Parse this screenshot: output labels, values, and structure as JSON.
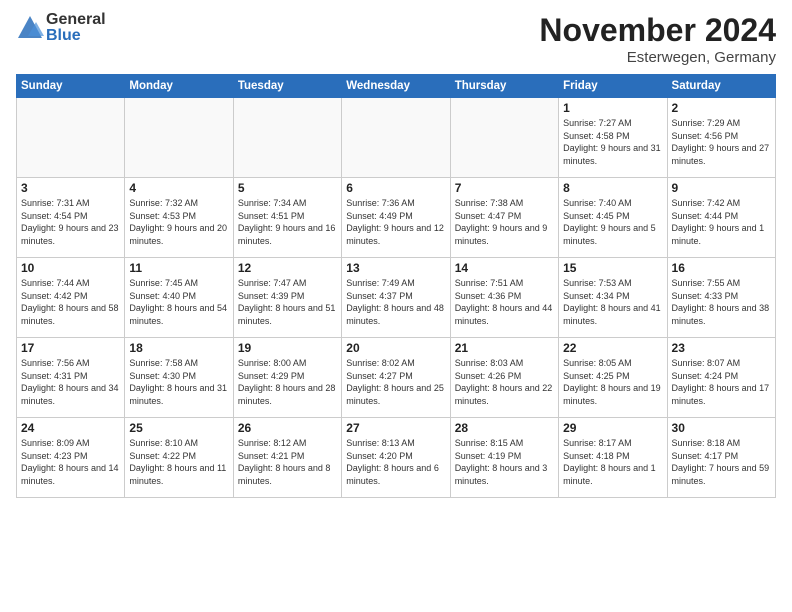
{
  "logo": {
    "general": "General",
    "blue": "Blue"
  },
  "header": {
    "month": "November 2024",
    "location": "Esterwegen, Germany"
  },
  "weekdays": [
    "Sunday",
    "Monday",
    "Tuesday",
    "Wednesday",
    "Thursday",
    "Friday",
    "Saturday"
  ],
  "weeks": [
    [
      {
        "day": "",
        "info": ""
      },
      {
        "day": "",
        "info": ""
      },
      {
        "day": "",
        "info": ""
      },
      {
        "day": "",
        "info": ""
      },
      {
        "day": "",
        "info": ""
      },
      {
        "day": "1",
        "info": "Sunrise: 7:27 AM\nSunset: 4:58 PM\nDaylight: 9 hours and 31 minutes."
      },
      {
        "day": "2",
        "info": "Sunrise: 7:29 AM\nSunset: 4:56 PM\nDaylight: 9 hours and 27 minutes."
      }
    ],
    [
      {
        "day": "3",
        "info": "Sunrise: 7:31 AM\nSunset: 4:54 PM\nDaylight: 9 hours and 23 minutes."
      },
      {
        "day": "4",
        "info": "Sunrise: 7:32 AM\nSunset: 4:53 PM\nDaylight: 9 hours and 20 minutes."
      },
      {
        "day": "5",
        "info": "Sunrise: 7:34 AM\nSunset: 4:51 PM\nDaylight: 9 hours and 16 minutes."
      },
      {
        "day": "6",
        "info": "Sunrise: 7:36 AM\nSunset: 4:49 PM\nDaylight: 9 hours and 12 minutes."
      },
      {
        "day": "7",
        "info": "Sunrise: 7:38 AM\nSunset: 4:47 PM\nDaylight: 9 hours and 9 minutes."
      },
      {
        "day": "8",
        "info": "Sunrise: 7:40 AM\nSunset: 4:45 PM\nDaylight: 9 hours and 5 minutes."
      },
      {
        "day": "9",
        "info": "Sunrise: 7:42 AM\nSunset: 4:44 PM\nDaylight: 9 hours and 1 minute."
      }
    ],
    [
      {
        "day": "10",
        "info": "Sunrise: 7:44 AM\nSunset: 4:42 PM\nDaylight: 8 hours and 58 minutes."
      },
      {
        "day": "11",
        "info": "Sunrise: 7:45 AM\nSunset: 4:40 PM\nDaylight: 8 hours and 54 minutes."
      },
      {
        "day": "12",
        "info": "Sunrise: 7:47 AM\nSunset: 4:39 PM\nDaylight: 8 hours and 51 minutes."
      },
      {
        "day": "13",
        "info": "Sunrise: 7:49 AM\nSunset: 4:37 PM\nDaylight: 8 hours and 48 minutes."
      },
      {
        "day": "14",
        "info": "Sunrise: 7:51 AM\nSunset: 4:36 PM\nDaylight: 8 hours and 44 minutes."
      },
      {
        "day": "15",
        "info": "Sunrise: 7:53 AM\nSunset: 4:34 PM\nDaylight: 8 hours and 41 minutes."
      },
      {
        "day": "16",
        "info": "Sunrise: 7:55 AM\nSunset: 4:33 PM\nDaylight: 8 hours and 38 minutes."
      }
    ],
    [
      {
        "day": "17",
        "info": "Sunrise: 7:56 AM\nSunset: 4:31 PM\nDaylight: 8 hours and 34 minutes."
      },
      {
        "day": "18",
        "info": "Sunrise: 7:58 AM\nSunset: 4:30 PM\nDaylight: 8 hours and 31 minutes."
      },
      {
        "day": "19",
        "info": "Sunrise: 8:00 AM\nSunset: 4:29 PM\nDaylight: 8 hours and 28 minutes."
      },
      {
        "day": "20",
        "info": "Sunrise: 8:02 AM\nSunset: 4:27 PM\nDaylight: 8 hours and 25 minutes."
      },
      {
        "day": "21",
        "info": "Sunrise: 8:03 AM\nSunset: 4:26 PM\nDaylight: 8 hours and 22 minutes."
      },
      {
        "day": "22",
        "info": "Sunrise: 8:05 AM\nSunset: 4:25 PM\nDaylight: 8 hours and 19 minutes."
      },
      {
        "day": "23",
        "info": "Sunrise: 8:07 AM\nSunset: 4:24 PM\nDaylight: 8 hours and 17 minutes."
      }
    ],
    [
      {
        "day": "24",
        "info": "Sunrise: 8:09 AM\nSunset: 4:23 PM\nDaylight: 8 hours and 14 minutes."
      },
      {
        "day": "25",
        "info": "Sunrise: 8:10 AM\nSunset: 4:22 PM\nDaylight: 8 hours and 11 minutes."
      },
      {
        "day": "26",
        "info": "Sunrise: 8:12 AM\nSunset: 4:21 PM\nDaylight: 8 hours and 8 minutes."
      },
      {
        "day": "27",
        "info": "Sunrise: 8:13 AM\nSunset: 4:20 PM\nDaylight: 8 hours and 6 minutes."
      },
      {
        "day": "28",
        "info": "Sunrise: 8:15 AM\nSunset: 4:19 PM\nDaylight: 8 hours and 3 minutes."
      },
      {
        "day": "29",
        "info": "Sunrise: 8:17 AM\nSunset: 4:18 PM\nDaylight: 8 hours and 1 minute."
      },
      {
        "day": "30",
        "info": "Sunrise: 8:18 AM\nSunset: 4:17 PM\nDaylight: 7 hours and 59 minutes."
      }
    ]
  ]
}
